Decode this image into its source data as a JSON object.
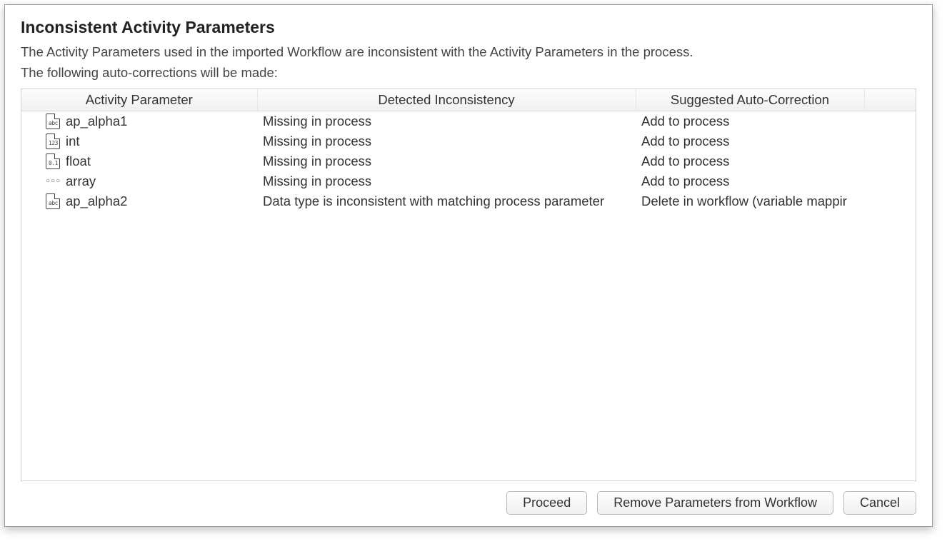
{
  "dialog": {
    "title": "Inconsistent Activity Parameters",
    "desc_line1": "The Activity Parameters used in the imported Workflow are inconsistent with the Activity Parameters in the process.",
    "desc_line2": "The following auto-corrections will be made:"
  },
  "table": {
    "headers": {
      "col1": "Activity Parameter",
      "col2": "Detected Inconsistency",
      "col3": "Suggested Auto-Correction"
    },
    "rows": [
      {
        "icon": "file-abc",
        "name": "ap_alpha1",
        "inconsistency": "Missing in process",
        "correction": "Add to process"
      },
      {
        "icon": "file-123",
        "name": "int",
        "inconsistency": "Missing in process",
        "correction": "Add to process"
      },
      {
        "icon": "file-0d1",
        "name": "float",
        "inconsistency": "Missing in process",
        "correction": "Add to process"
      },
      {
        "icon": "array",
        "name": "array",
        "inconsistency": "Missing in process",
        "correction": "Add to process"
      },
      {
        "icon": "file-abc",
        "name": "ap_alpha2",
        "inconsistency": "Data type is inconsistent with matching process parameter",
        "correction": "Delete in workflow (variable mappir"
      }
    ]
  },
  "buttons": {
    "proceed": "Proceed",
    "remove": "Remove Parameters from Workflow",
    "cancel": "Cancel"
  }
}
